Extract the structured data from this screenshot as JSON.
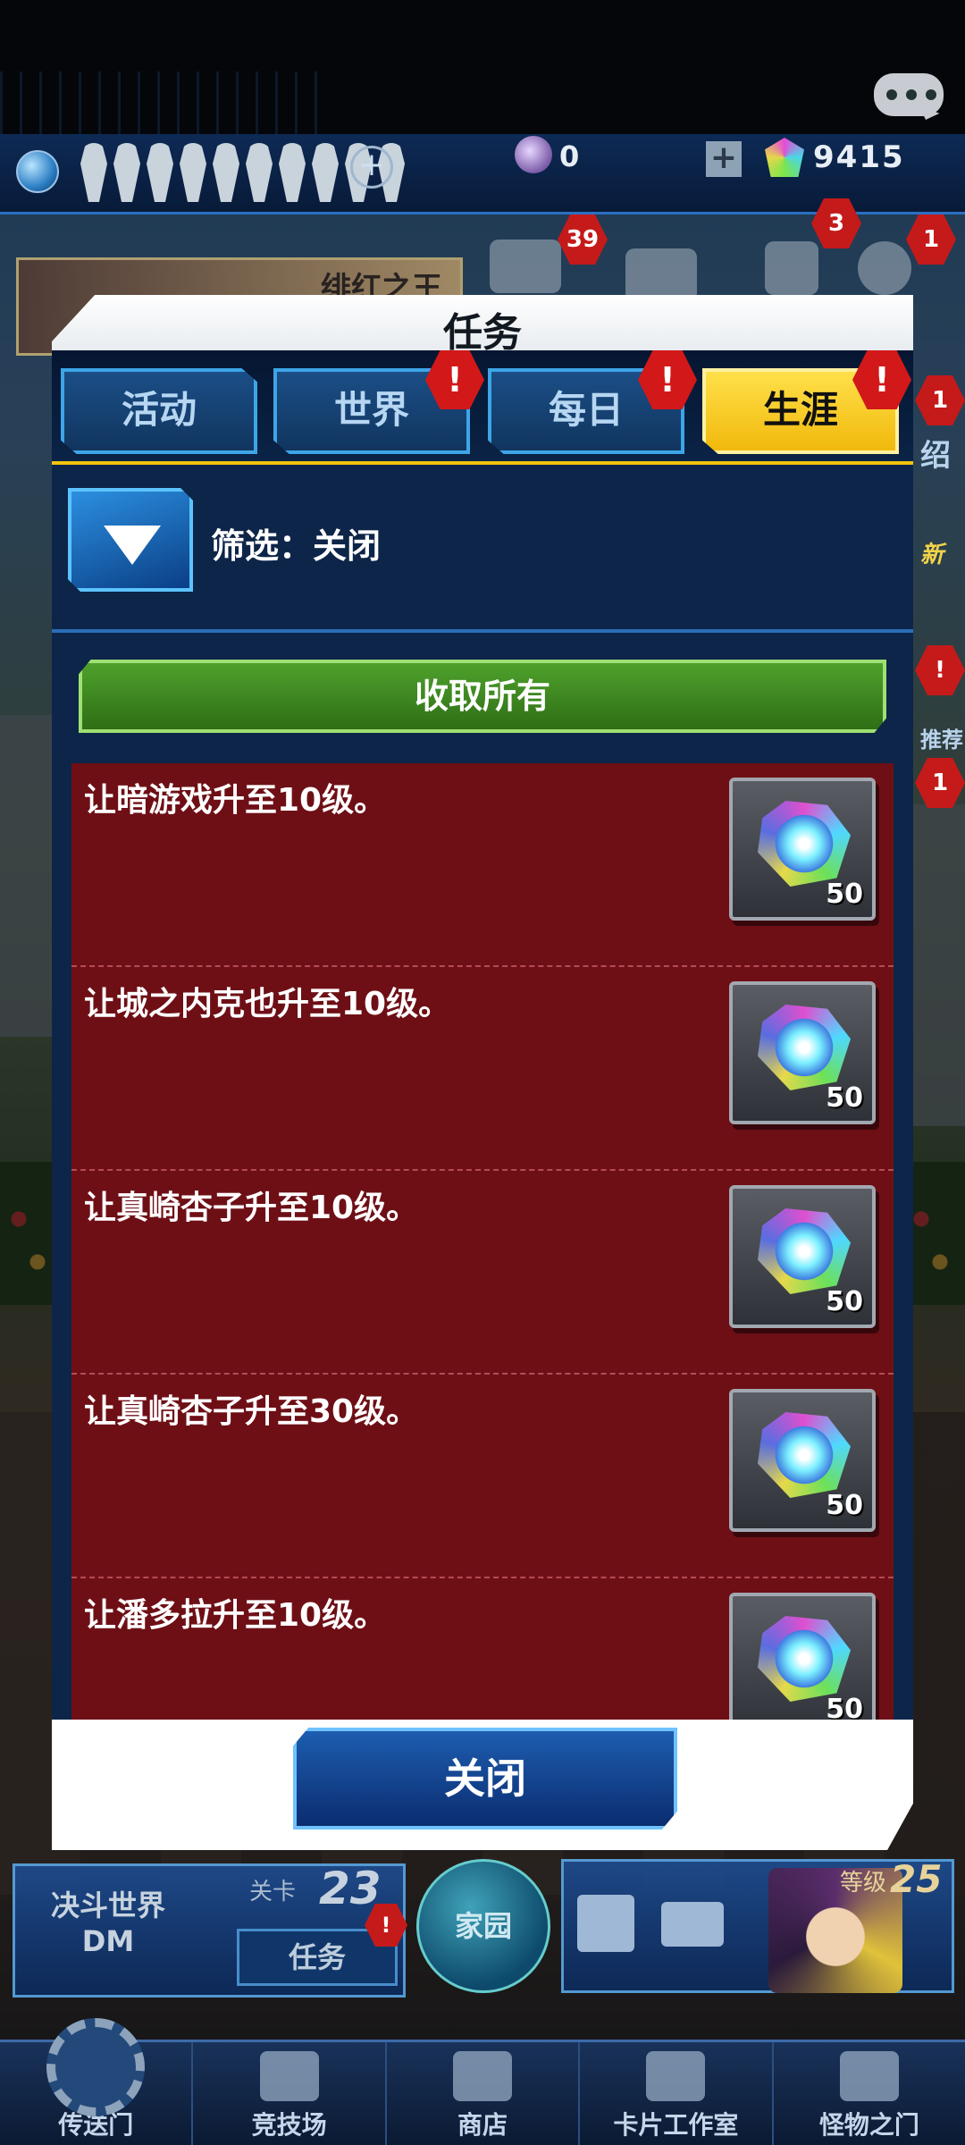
{
  "status": {
    "orb_count": "0",
    "gem_count": "9415"
  },
  "background": {
    "banner_text": "绯红之王",
    "badges": [
      "39",
      "3",
      "1",
      "1",
      "!",
      "1"
    ],
    "side_label": "绍",
    "side_tag_new": "新",
    "side_tag_rec": "推荐"
  },
  "dialog": {
    "title": "任务",
    "tabs": [
      {
        "label": "活动",
        "alert": ""
      },
      {
        "label": "世界",
        "alert": "!"
      },
      {
        "label": "每日",
        "alert": "!"
      },
      {
        "label": "生涯",
        "alert": "!"
      }
    ],
    "active_tab": "生涯",
    "filter_label": "筛选：关闭",
    "collect_all": "收取所有",
    "missions": [
      {
        "text": "让暗游戏升至10级。",
        "reward": "50",
        "reward_icon": "gem-icon"
      },
      {
        "text": "让城之内克也升至10级。",
        "reward": "50",
        "reward_icon": "gem-icon"
      },
      {
        "text": "让真崎杏子升至10级。",
        "reward": "50",
        "reward_icon": "gem-icon"
      },
      {
        "text": "让真崎杏子升至30级。",
        "reward": "50",
        "reward_icon": "gem-icon"
      },
      {
        "text": "让潘多拉升至10级。",
        "reward": "50",
        "reward_icon": "gem-icon"
      }
    ],
    "close_label": "关闭"
  },
  "hud": {
    "world_line1": "决斗世界",
    "world_line2": "DM",
    "stage_label": "关卡",
    "stage_num": "23",
    "mission_label": "任务",
    "mission_alert": "!",
    "home_label": "家园",
    "level_label": "等级",
    "level_num": "25"
  },
  "nav": [
    {
      "label": "传送门",
      "icon": "gear-icon"
    },
    {
      "label": "竞技场",
      "icon": "crossed-swords-icon"
    },
    {
      "label": "商店",
      "icon": "cart-icon"
    },
    {
      "label": "卡片工作室",
      "icon": "cards-icon"
    },
    {
      "label": "怪物之门",
      "icon": "monster-gate-icon"
    }
  ],
  "colors": {
    "active_tab": "#f1c40f",
    "mission_bg": "#6e0f16",
    "collect_button": "#3f8a23",
    "close_button": "#1d5db0",
    "alert_badge": "#d21818"
  }
}
